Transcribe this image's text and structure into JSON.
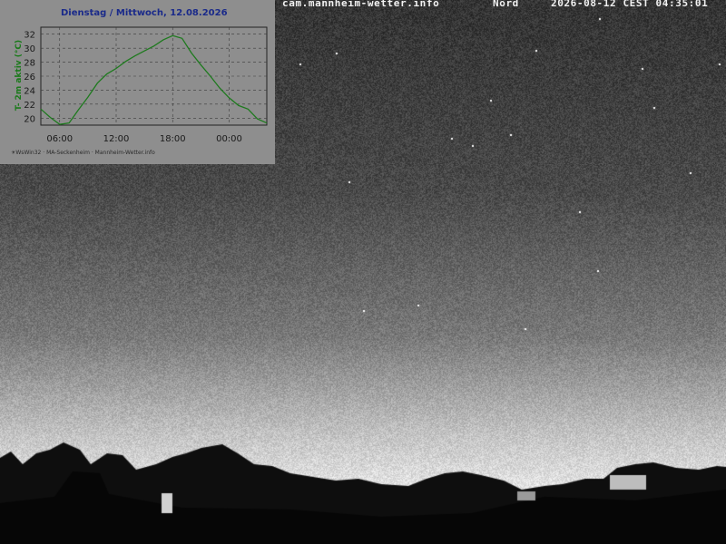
{
  "overlay": {
    "host": "cam.mannheim-wetter.info",
    "direction": "Nord",
    "timestamp": "2026-08-12 CEST 04:35:01"
  },
  "colors": {
    "sky_top": "#3c3c3c",
    "sky_horizon": "#e8e8e8",
    "inset_bg": "#8e8e8e",
    "temp_line": "#1e7a1e",
    "title_color": "#1a2a8a"
  },
  "chart_data": {
    "type": "line",
    "title": "Dienstag / Mittwoch, 12.08.2026",
    "ylabel": "T- 2m aktiv (°C)",
    "xlabel": "",
    "ylim": [
      19,
      33
    ],
    "yticks": [
      20,
      22,
      24,
      26,
      28,
      30,
      32
    ],
    "xticks": [
      "06:00",
      "12:00",
      "18:00",
      "00:00"
    ],
    "x_hours": [
      4,
      5,
      6,
      7,
      8,
      9,
      10,
      11,
      12,
      13,
      14,
      15,
      16,
      17,
      18,
      19,
      20,
      21,
      22,
      23,
      24,
      25,
      26,
      27,
      28
    ],
    "values": [
      21.3,
      20.1,
      19.1,
      19.3,
      21.2,
      23.0,
      25.0,
      26.3,
      27.1,
      28.1,
      28.9,
      29.6,
      30.3,
      31.2,
      31.8,
      31.4,
      29.3,
      27.6,
      26.0,
      24.3,
      22.9,
      21.8,
      21.3,
      19.9,
      19.3
    ],
    "grid": true,
    "footer": "☀WsWin32 · MA-Seckenheim · Mannheim-Wetter.info"
  }
}
